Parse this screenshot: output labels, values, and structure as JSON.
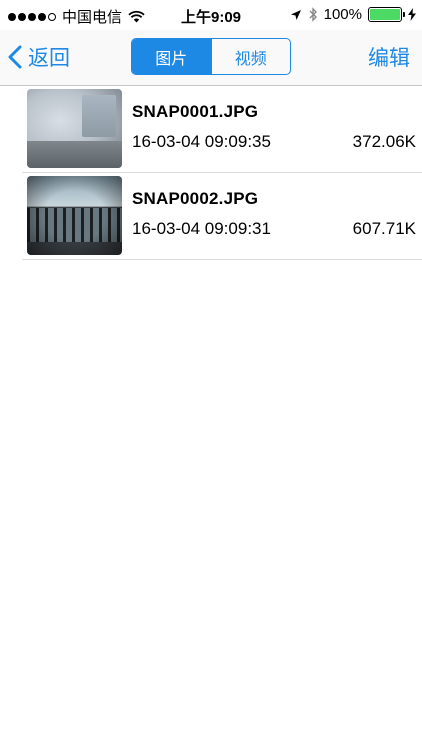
{
  "status_bar": {
    "carrier": "中国电信",
    "time": "上午9:09",
    "battery": "100%"
  },
  "nav": {
    "back_label": "返回",
    "segments": [
      "图片",
      "视频"
    ],
    "active_segment": "图片",
    "edit_label": "编辑"
  },
  "files": [
    {
      "name": "SNAP0001.JPG",
      "date": "16-03-04 09:09:35",
      "size": "372.06K"
    },
    {
      "name": "SNAP0002.JPG",
      "date": "16-03-04 09:09:31",
      "size": "607.71K"
    }
  ],
  "colors": {
    "accent": "#1e88e5",
    "battery": "#4cd964"
  }
}
